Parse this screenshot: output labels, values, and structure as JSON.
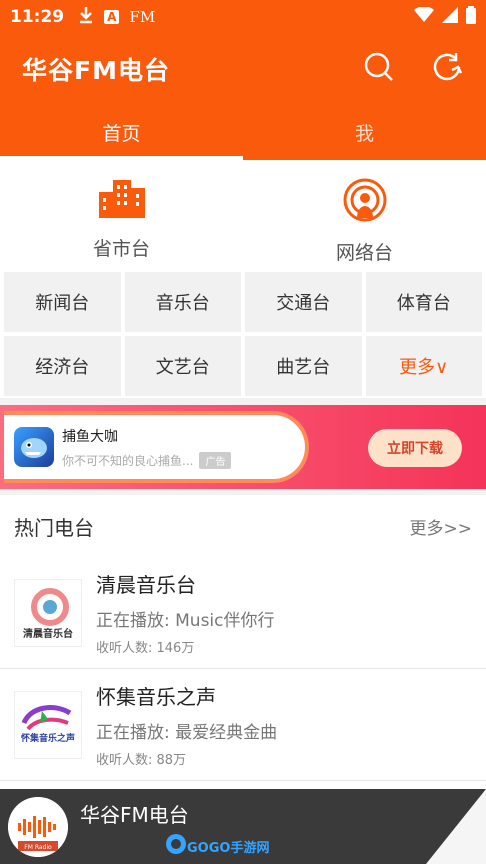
{
  "status": {
    "time": "11:29",
    "a_icon": "A",
    "fm_label": "FM"
  },
  "app": {
    "title": "华谷FM电台"
  },
  "tabs": [
    {
      "label": "首页"
    },
    {
      "label": "我"
    }
  ],
  "categories": [
    {
      "label": "省市台",
      "icon": "building-icon"
    },
    {
      "label": "网络台",
      "icon": "broadcast-icon"
    }
  ],
  "grid": [
    "新闻台",
    "音乐台",
    "交通台",
    "体育台",
    "经济台",
    "文艺台",
    "曲艺台",
    "更多∨"
  ],
  "ad": {
    "title": "捕鱼大咖",
    "subtitle": "你不可不知的良心捕鱼...",
    "tag": "广告",
    "button": "立即下载"
  },
  "hot": {
    "title": "热门电台",
    "more": "更多>>",
    "stations": [
      {
        "name": "清晨音乐台",
        "playing": "正在播放: Music伴你行",
        "listeners": "收听人数: 146万",
        "logo_text": "清晨音乐台"
      },
      {
        "name": "怀集音乐之声",
        "playing": "正在播放: 最爱经典金曲",
        "listeners": "收听人数: 88万",
        "logo_text": "怀集音乐之声"
      }
    ]
  },
  "player": {
    "title": "华谷FM电台",
    "avatar_text": "FM Radio",
    "watermark": "GOGO手游网"
  },
  "colors": {
    "brand": "#fa5a0c",
    "ad_gradient_start": "#fa6d7e",
    "ad_gradient_end": "#f5335a",
    "player_bg": "#3a3a3a"
  }
}
